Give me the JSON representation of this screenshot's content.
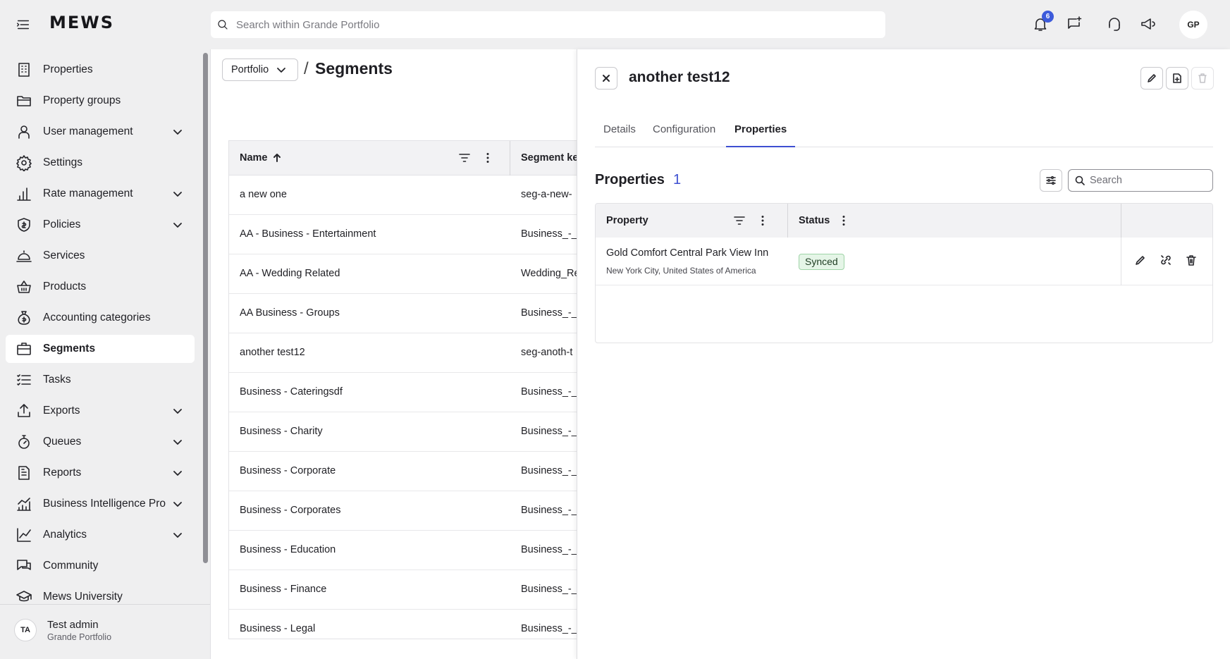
{
  "app": {
    "logo": "MEWS"
  },
  "topbar": {
    "search_placeholder": "Search within Grande Portfolio",
    "notification_count": "6",
    "avatar_initials": "GP"
  },
  "sidebar": {
    "items": [
      {
        "label": "Properties",
        "icon": "building-icon",
        "expandable": false
      },
      {
        "label": "Property groups",
        "icon": "folder-icon",
        "expandable": false
      },
      {
        "label": "User management",
        "icon": "user-icon",
        "expandable": true
      },
      {
        "label": "Settings",
        "icon": "gear-icon",
        "expandable": false
      },
      {
        "label": "Rate management",
        "icon": "bar-chart-icon",
        "expandable": true
      },
      {
        "label": "Policies",
        "icon": "shield-icon",
        "expandable": true
      },
      {
        "label": "Services",
        "icon": "bell-service-icon",
        "expandable": false
      },
      {
        "label": "Products",
        "icon": "basket-icon",
        "expandable": false
      },
      {
        "label": "Accounting categories",
        "icon": "money-bag-icon",
        "expandable": false
      },
      {
        "label": "Segments",
        "icon": "briefcase-icon",
        "expandable": false,
        "active": true
      },
      {
        "label": "Tasks",
        "icon": "task-list-icon",
        "expandable": false
      },
      {
        "label": "Exports",
        "icon": "export-icon",
        "expandable": true
      },
      {
        "label": "Queues",
        "icon": "stopwatch-icon",
        "expandable": true
      },
      {
        "label": "Reports",
        "icon": "report-icon",
        "expandable": true
      },
      {
        "label": "Business Intelligence Pro",
        "icon": "bi-chart-icon",
        "expandable": true
      },
      {
        "label": "Analytics",
        "icon": "line-chart-icon",
        "expandable": true
      },
      {
        "label": "Community",
        "icon": "chat-icon",
        "expandable": false
      },
      {
        "label": "Mews University",
        "icon": "graduation-cap-icon",
        "expandable": false
      }
    ],
    "user": {
      "initials": "TA",
      "name": "Test admin",
      "org": "Grande Portfolio"
    }
  },
  "main": {
    "breadcrumb_root": "Portfolio",
    "breadcrumb_sep": "/",
    "title": "Segments",
    "columns": {
      "name": "Name",
      "segment_key": "Segment ke"
    },
    "rows": [
      {
        "name": "a new one",
        "key": "seg-a-new-"
      },
      {
        "name": "AA - Business - Entertainment",
        "key": "Business_-_"
      },
      {
        "name": "AA - Wedding Related",
        "key": "Wedding_Re"
      },
      {
        "name": "AA Business - Groups",
        "key": "Business_-_"
      },
      {
        "name": "another test12",
        "key": "seg-anoth-t"
      },
      {
        "name": "Business - Cateringsdf",
        "key": "Business_-_"
      },
      {
        "name": "Business - Charity",
        "key": "Business_-_"
      },
      {
        "name": "Business - Corporate",
        "key": "Business_-_"
      },
      {
        "name": "Business - Corporates",
        "key": "Business_-_"
      },
      {
        "name": "Business - Education",
        "key": "Business_-_"
      },
      {
        "name": "Business - Finance",
        "key": "Business_-_"
      },
      {
        "name": "Business - Legal",
        "key": "Business_-_"
      }
    ]
  },
  "panel": {
    "title": "another test12",
    "tabs": [
      "Details",
      "Configuration",
      "Properties"
    ],
    "active_tab": "Properties",
    "section_title": "Properties",
    "section_count": "1",
    "search_placeholder": "Search",
    "columns": {
      "property": "Property",
      "status": "Status"
    },
    "rows": [
      {
        "property": "Gold Comfort Central Park View Inn",
        "location": "New York City, United States of America",
        "status": "Synced"
      }
    ]
  },
  "colors": {
    "accent": "#3d4fd1",
    "synced_bg": "#e5f5e7",
    "synced_border": "#9fd4a7",
    "active_nav_bg": "#ffffff"
  }
}
